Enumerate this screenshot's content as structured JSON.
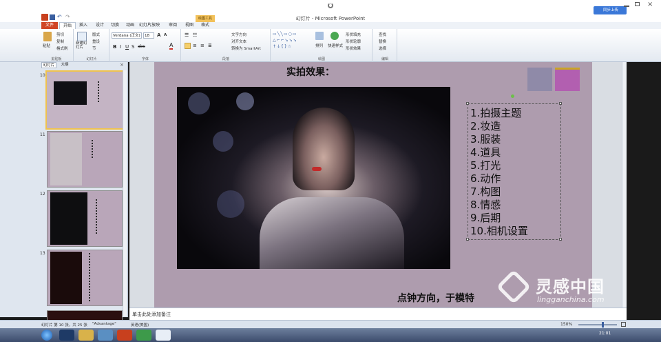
{
  "window": {
    "title": "幻灯片 - Microsoft PowerPoint",
    "cloud_button": "同步上传"
  },
  "tabs": [
    {
      "label": "文件"
    },
    {
      "label": "开始"
    },
    {
      "label": "插入"
    },
    {
      "label": "设计"
    },
    {
      "label": "切换"
    },
    {
      "label": "动画"
    },
    {
      "label": "幻灯片放映"
    },
    {
      "label": "审阅"
    },
    {
      "label": "视图"
    },
    {
      "label": "格式"
    }
  ],
  "context_tab_header": "绘图工具",
  "ribbon": {
    "clipboard": {
      "label": "剪贴板",
      "paste": "粘贴",
      "cut": "剪切",
      "copy": "复制",
      "format_painter": "格式刷"
    },
    "slides": {
      "label": "幻灯片",
      "new_slide": "新建幻灯片",
      "layout": "版式",
      "reset": "重设",
      "section": "节"
    },
    "font": {
      "label": "字体",
      "font_name": "Verdana (正文)",
      "font_size": "18",
      "grow": "A",
      "shrink": "A"
    },
    "paragraph": {
      "label": "段落",
      "text_direction": "文字方向",
      "align_text": "对齐文本",
      "smartart": "转换为 SmartArt"
    },
    "drawing": {
      "label": "绘图",
      "arrange": "排列",
      "quick_styles": "快速样式",
      "shape_fill": "形状填充",
      "shape_outline": "形状轮廓",
      "shape_effects": "形状效果"
    },
    "editing": {
      "label": "编辑",
      "find": "查找",
      "replace": "替换",
      "select": "选择"
    }
  },
  "left_panel": {
    "tab_slides": "幻灯片",
    "tab_outline": "大纲",
    "thumbnails": [
      {
        "number": "10",
        "selected": true
      },
      {
        "number": "11",
        "selected": false
      },
      {
        "number": "12",
        "selected": false
      },
      {
        "number": "13",
        "selected": false
      }
    ]
  },
  "slide": {
    "title": "实拍效果：",
    "list_items": [
      "1.拍摄主题",
      "2.妆造",
      "3.服装",
      "4.道具",
      "5.打光",
      "6.动作",
      "7.构图",
      "8.情感",
      "9.后期",
      "10.相机设置"
    ],
    "footer_text": "点钟方向，于模特",
    "swatch_colors": [
      "#8f8aa8",
      "#b25fb0"
    ]
  },
  "notes": {
    "placeholder": "单击此处添加备注"
  },
  "status": {
    "slide_info": "幻灯片 第 10 张，共 25 张",
    "theme": "\"Advantage\"",
    "language": "英语(美国)",
    "zoom": "150%"
  },
  "watermark": {
    "brand": "灵感中国",
    "url": "lingganchina.com"
  },
  "clock": {
    "time": "21:01"
  }
}
